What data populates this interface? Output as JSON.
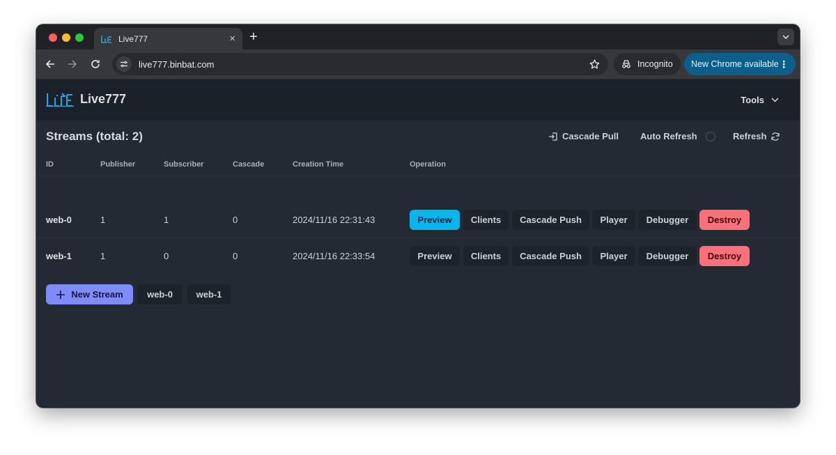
{
  "browser": {
    "tab_title": "Live777",
    "url": "live777.binbat.com",
    "incognito_label": "Incognito",
    "update_label": "New Chrome available"
  },
  "app": {
    "title": "Live777",
    "tools_label": "Tools"
  },
  "streams": {
    "title": "Streams (total: 2)",
    "cascade_pull": "Cascade Pull",
    "auto_refresh": "Auto Refresh",
    "refresh": "Refresh",
    "columns": [
      "ID",
      "Publisher",
      "Subscriber",
      "Cascade",
      "Creation Time",
      "Operation"
    ],
    "rows": [
      {
        "id": "web-0",
        "publisher": "1",
        "subscriber": "1",
        "cascade": "0",
        "creation_time": "2024/11/16 22:31:43",
        "preview_active": true
      },
      {
        "id": "web-1",
        "publisher": "1",
        "subscriber": "0",
        "cascade": "0",
        "creation_time": "2024/11/16 22:33:54",
        "preview_active": false
      }
    ],
    "operations": {
      "preview": "Preview",
      "clients": "Clients",
      "cascade_push": "Cascade Push",
      "player": "Player",
      "debugger": "Debugger",
      "destroy": "Destroy"
    },
    "new_stream": "New Stream",
    "stream_tabs": [
      "web-0",
      "web-1"
    ]
  },
  "colors": {
    "accent": "#06b6f0",
    "danger": "#f8717a",
    "new_stream": "#7f8cf8",
    "logo": "#2aa3e0"
  }
}
